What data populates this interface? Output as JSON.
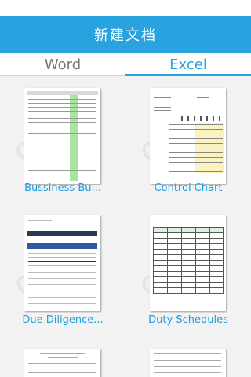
{
  "header": {
    "title": "新建文档"
  },
  "tabs": [
    {
      "label": "Word",
      "active": false
    },
    {
      "label": "Excel",
      "active": true
    }
  ],
  "watermark": "office",
  "templates": [
    {
      "label": "Bussiness Bu...",
      "thumbnail": "business-budget-spreadsheet"
    },
    {
      "label": "Control Chart",
      "thumbnail": "control-chart-spreadsheet"
    },
    {
      "label": "Due Diligence...",
      "thumbnail": "due-diligence-document-list"
    },
    {
      "label": "Duty Schedules",
      "thumbnail": "duty-schedule-table"
    }
  ],
  "colors": {
    "accent": "#29a3e0",
    "label": "#1aa0e0"
  }
}
